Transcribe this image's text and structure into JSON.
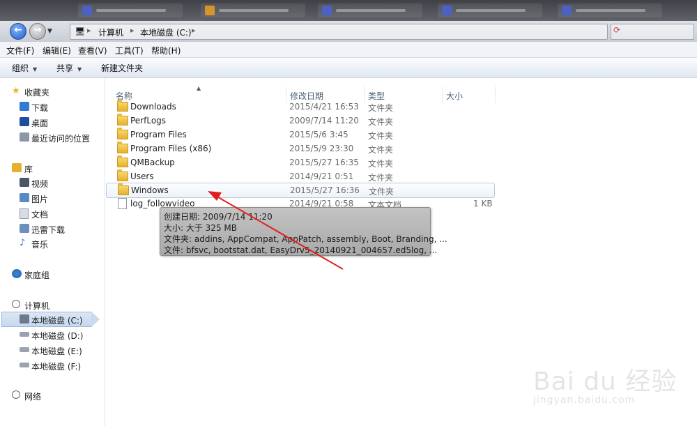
{
  "addressbar": {
    "crumbs": [
      "计算机",
      "本地磁盘 (C:)"
    ]
  },
  "menu": [
    "文件(F)",
    "编辑(E)",
    "查看(V)",
    "工具(T)",
    "帮助(H)"
  ],
  "toolbar": {
    "organize": "组织",
    "share": "共享",
    "new_folder": "新建文件夹"
  },
  "nav": {
    "favorites": "收藏夹",
    "downloads": "下载",
    "desktop": "桌面",
    "recent": "最近访问的位置",
    "libraries": "库",
    "videos": "视频",
    "pictures": "图片",
    "documents": "文档",
    "thunder": "迅雷下载",
    "music": "音乐",
    "homegroup": "家庭组",
    "computer": "计算机",
    "drive_c": "本地磁盘 (C:)",
    "drive_d": "本地磁盘 (D:)",
    "drive_e": "本地磁盘 (E:)",
    "drive_f": "本地磁盘 (F:)",
    "network": "网络"
  },
  "columns": {
    "name": "名称",
    "date": "修改日期",
    "type": "类型",
    "size": "大小"
  },
  "files": [
    {
      "name": "Downloads",
      "date": "2015/4/21 16:53",
      "type": "文件夹",
      "size": ""
    },
    {
      "name": "PerfLogs",
      "date": "2009/7/14 11:20",
      "type": "文件夹",
      "size": ""
    },
    {
      "name": "Program Files",
      "date": "2015/5/6 3:45",
      "type": "文件夹",
      "size": ""
    },
    {
      "name": "Program Files (x86)",
      "date": "2015/5/9 23:30",
      "type": "文件夹",
      "size": ""
    },
    {
      "name": "QMBackup",
      "date": "2015/5/27 16:35",
      "type": "文件夹",
      "size": ""
    },
    {
      "name": "Users",
      "date": "2014/9/21 0:51",
      "type": "文件夹",
      "size": ""
    },
    {
      "name": "Windows",
      "date": "2015/5/27 16:36",
      "type": "文件夹",
      "size": ""
    },
    {
      "name": "log_followvideo",
      "date": "2014/9/21 0:58",
      "type": "文本文档",
      "size": "1 KB"
    }
  ],
  "tooltip": {
    "created": "创建日期: 2009/7/14 11:20",
    "size": "大小: 大于 325 MB",
    "folders": "文件夹: addins, AppCompat, AppPatch, assembly, Boot, Branding, ...",
    "files": "文件: bfsvc, bootstat.dat, EasyDrv5_20140921_004657.ed5log, ..."
  },
  "watermark": {
    "brand": "Bai du 经验",
    "url": "jingyan.baidu.com"
  },
  "colors": {
    "annotation_arrow": "#e02020",
    "selection": "#c5d9f1"
  }
}
